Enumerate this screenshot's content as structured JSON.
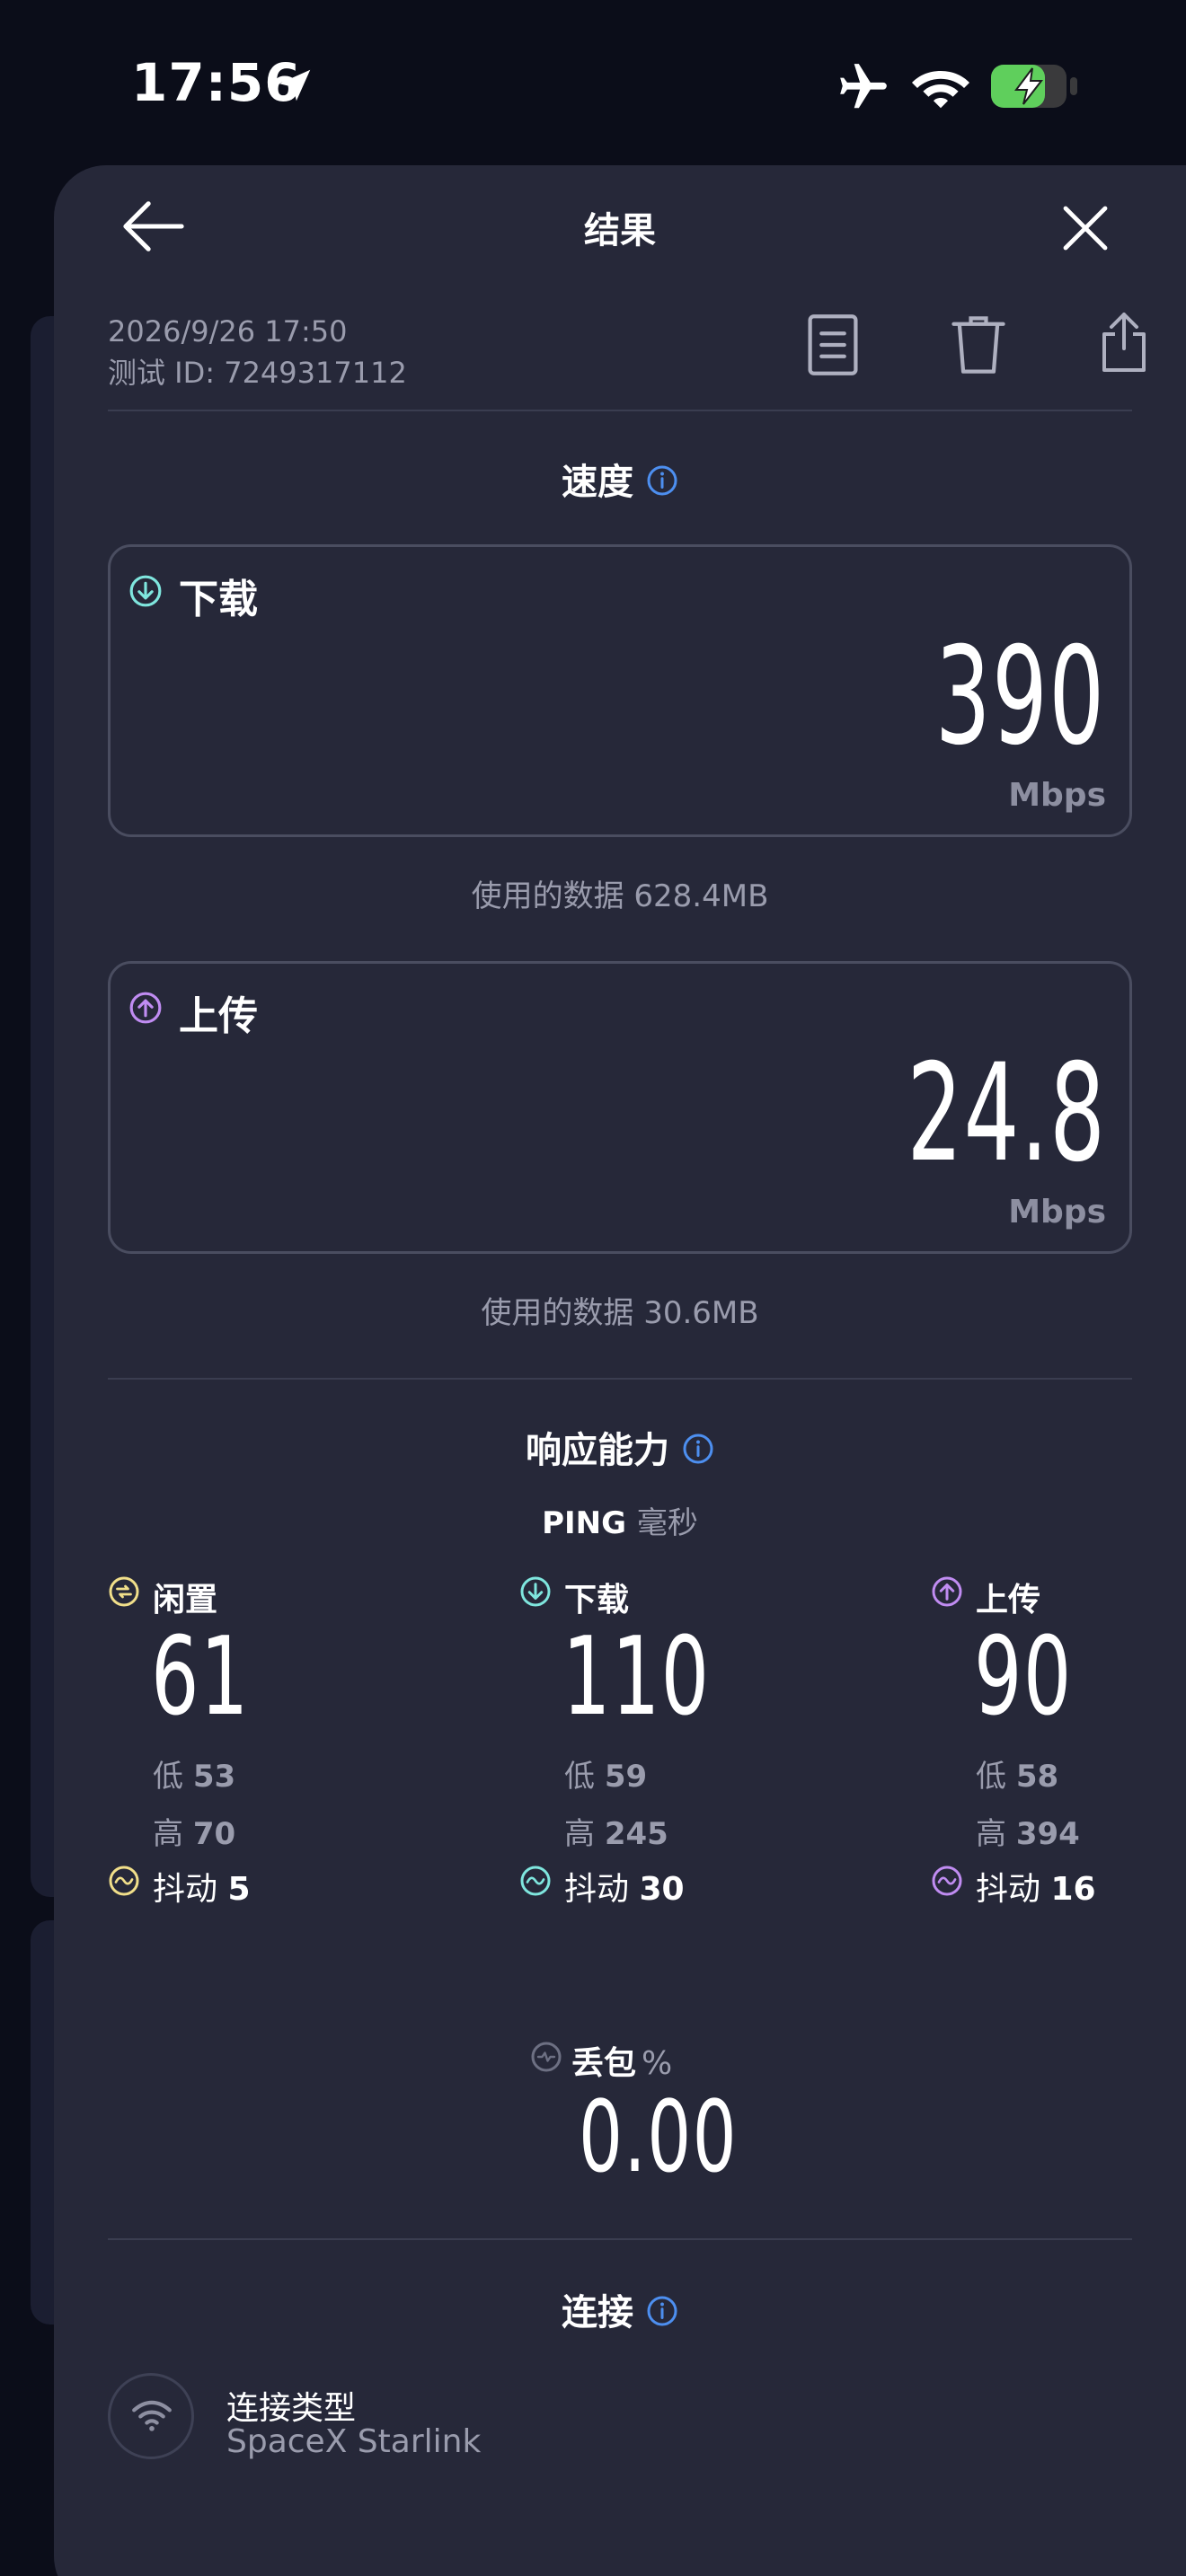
{
  "status_bar": {
    "time": "17:56"
  },
  "header": {
    "title": "结果"
  },
  "meta": {
    "date": "2026/9/26 17:50",
    "test_id": "测试 ID: 7249317112"
  },
  "speed": {
    "title": "速度",
    "download": {
      "label": "下载",
      "value": "390",
      "unit": "Mbps",
      "data_used": "使用的数据 628.4MB"
    },
    "upload": {
      "label": "上传",
      "value": "24.8",
      "unit": "Mbps",
      "data_used": "使用的数据 30.6MB"
    }
  },
  "responsiveness": {
    "title": "响应能力",
    "ping_label": "PING",
    "ping_unit": "毫秒",
    "columns": [
      {
        "label": "闲置",
        "value": "61",
        "low_label": "低",
        "low": "53",
        "high_label": "高",
        "high": "70",
        "jitter_label": "抖动",
        "jitter": "5",
        "color": "#f1df8a"
      },
      {
        "label": "下载",
        "value": "110",
        "low_label": "低",
        "low": "59",
        "high_label": "高",
        "high": "245",
        "jitter_label": "抖动",
        "jitter": "30",
        "color": "#7fe6de"
      },
      {
        "label": "上传",
        "value": "90",
        "low_label": "低",
        "low": "58",
        "high_label": "高",
        "high": "394",
        "jitter_label": "抖动",
        "jitter": "16",
        "color": "#c08cf2"
      }
    ]
  },
  "packet_loss": {
    "label": "丢包",
    "unit": "%",
    "value": "0.00"
  },
  "connection": {
    "title": "连接",
    "type_label": "连接类型",
    "type_value": "SpaceX Starlink"
  },
  "colors": {
    "download": "#7fe6de",
    "upload": "#c08cf2",
    "idle": "#f1df8a",
    "info": "#4d8ff0",
    "background": "#0b0d19",
    "sheet": "#262839"
  }
}
